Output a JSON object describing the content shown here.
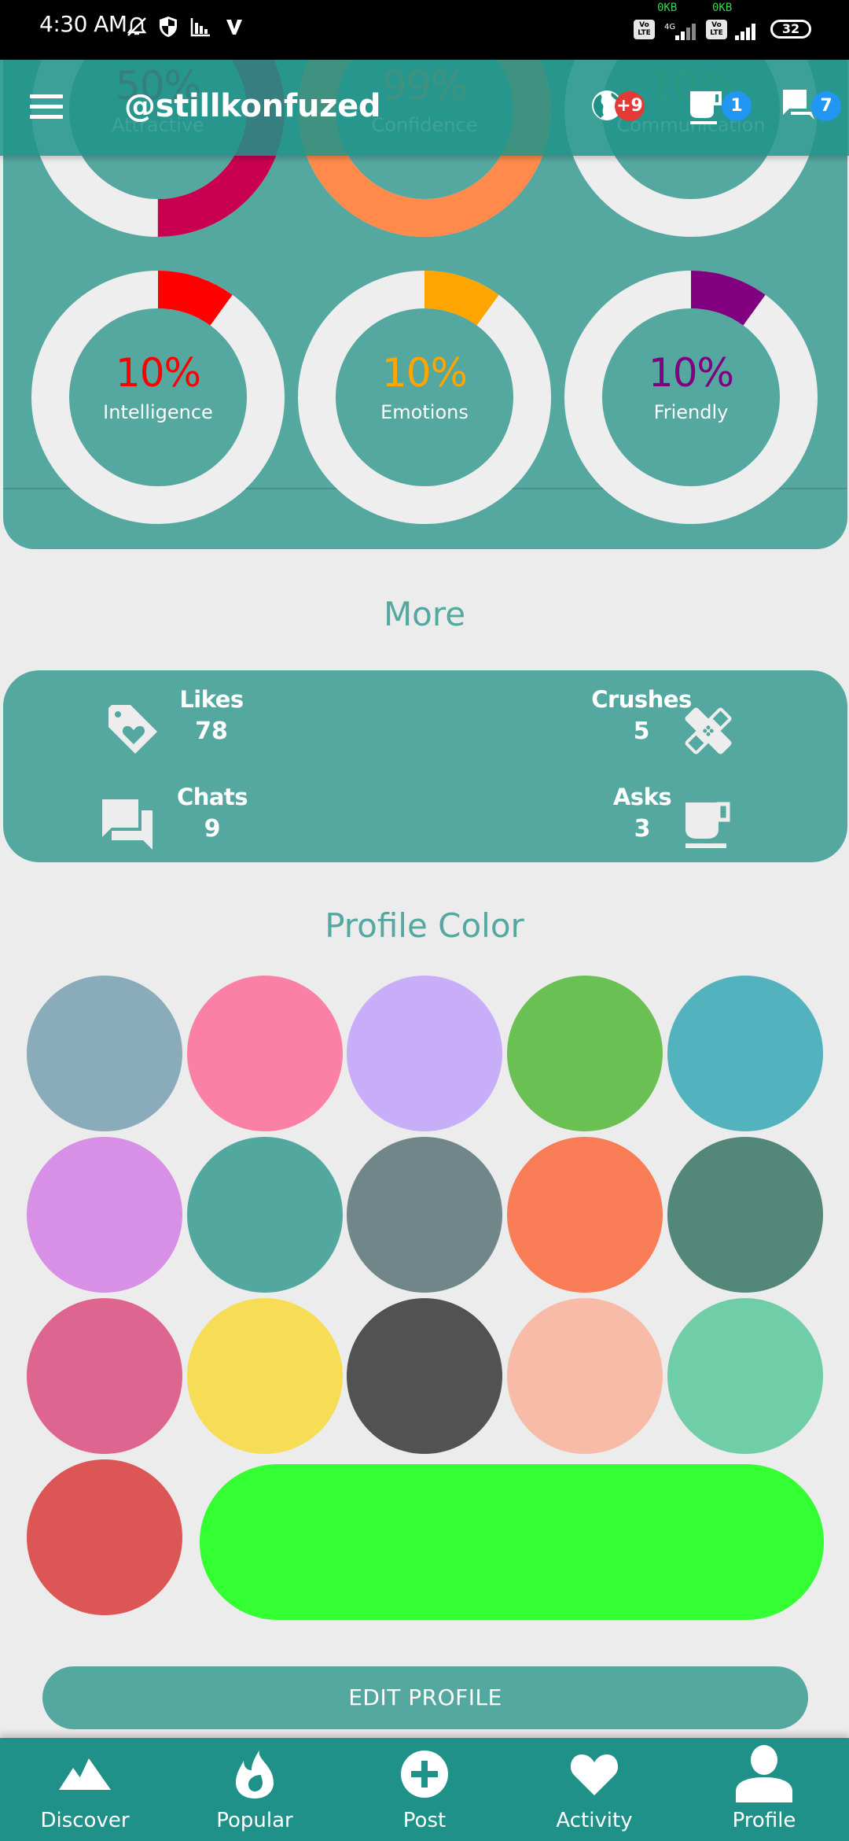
{
  "status_bar": {
    "time": "4:30 AM",
    "icons": [
      "bell-off-icon",
      "shield-icon",
      "stats-icon",
      "vpn-v-icon"
    ],
    "sim1": {
      "speed": "0KB",
      "volte": "Vo LTE",
      "network": "4G"
    },
    "sim2": {
      "speed": "0KB",
      "volte": "Vo LTE"
    },
    "battery": "32"
  },
  "app_bar": {
    "username": "@stillkonfuzed",
    "globe_badge": "+9",
    "cup_badge": "1",
    "chat_badge": "7",
    "colors": {
      "red_badge": "#E53935",
      "blue_badge": "#2196F3"
    }
  },
  "traits": [
    {
      "label": "Attractive",
      "value": 50,
      "text": "50%",
      "color": "#C8004F"
    },
    {
      "label": "Confidence",
      "value": 99,
      "text": "99%",
      "color": "#FF8A4C"
    },
    {
      "label": "Communication",
      "value": 10,
      "text": "10%",
      "color": "#6ABF4B"
    },
    {
      "label": "Intelligence",
      "value": 10,
      "text": "10%",
      "color": "#FF0000"
    },
    {
      "label": "Emotions",
      "value": 10,
      "text": "10%",
      "color": "#FFA500"
    },
    {
      "label": "Friendly",
      "value": 10,
      "text": "10%",
      "color": "#800080"
    }
  ],
  "more": {
    "title": "More",
    "likes": {
      "label": "Likes",
      "value": "78"
    },
    "crushes": {
      "label": "Crushes",
      "value": "5"
    },
    "chats": {
      "label": "Chats",
      "value": "9"
    },
    "asks": {
      "label": "Asks",
      "value": "3"
    }
  },
  "profile_color": {
    "title": "Profile Color",
    "swatches": [
      "#8AACBA",
      "#FA80A6",
      "#C8AEF8",
      "#6AC053",
      "#52B2BE",
      "#D790E6",
      "#52A89F",
      "#718689",
      "#F87C55",
      "#53877A",
      "#DE6590",
      "#F7DC55",
      "#525252",
      "#F7BBA7",
      "#6FCDA8",
      "#DC5656"
    ],
    "selected": "#33FF33"
  },
  "edit_profile_label": "EDIT PROFILE",
  "bottom_nav": [
    {
      "label": "Discover",
      "icon": "mountain-icon"
    },
    {
      "label": "Popular",
      "icon": "flame-icon"
    },
    {
      "label": "Post",
      "icon": "plus-circle-icon"
    },
    {
      "label": "Activity",
      "icon": "heart-icon"
    },
    {
      "label": "Profile",
      "icon": "person-icon"
    }
  ]
}
